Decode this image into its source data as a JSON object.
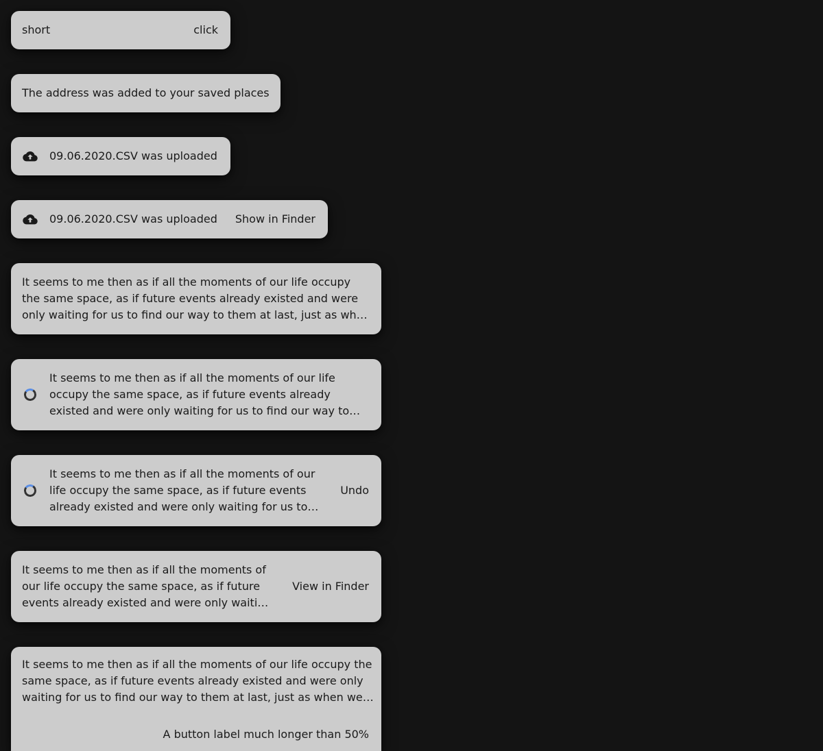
{
  "toasts": {
    "t1": {
      "message": "short",
      "action": "click"
    },
    "t2": {
      "message": "The address was added to your saved places"
    },
    "t3": {
      "icon": "cloud-upload-icon",
      "message": "09.06.2020.CSV was uploaded"
    },
    "t4": {
      "icon": "cloud-upload-icon",
      "message": "09.06.2020.CSV was uploaded",
      "action": "Show in Finder"
    },
    "t5": {
      "message": "It seems to me then as if all the moments of our life occupy the same space, as if future events already existed and were only waiting for us to find our way to them at last, just as when we have accepted an invitation and duly arrive in a certain house at a given time."
    },
    "t6": {
      "icon": "loading-spinner-icon",
      "message": "It seems to me then as if all the moments of our life occupy the same space, as if future events already existed and were only waiting for us to find our way to them at last, just as when we have accepted an invitation and duly arrive in a certain house at a given time."
    },
    "t7": {
      "icon": "loading-spinner-icon",
      "message": "It seems to me then as if all the moments of our life occupy the same space, as if future events already existed and were only waiting for us to find our way to them at last, just as when we have accepted an invitation and duly arrive in a certain house at a given time.",
      "action": "Undo"
    },
    "t8": {
      "message": "It seems to me then as if all the moments of our life occupy the same space, as if future events already existed and were only waiting for us to find our way to them at last, just as when we have accepted an invitation and duly arrive in a certain house at a given time.",
      "action": "View in Finder"
    },
    "t9": {
      "message": "It seems to me then as if all the moments of our life occupy the same space, as if future events already existed and were only waiting for us to find our way to them at last, just as when we have accepted an invitation and duly arrive in a certain house at a given time.",
      "action": "A button label much longer than 50%"
    }
  },
  "colors": {
    "background": "#141414",
    "toast": "#cccccc",
    "text": "#1a1a1a",
    "spinner_track": "#333333",
    "spinner_accent": "#5a8ee6"
  }
}
